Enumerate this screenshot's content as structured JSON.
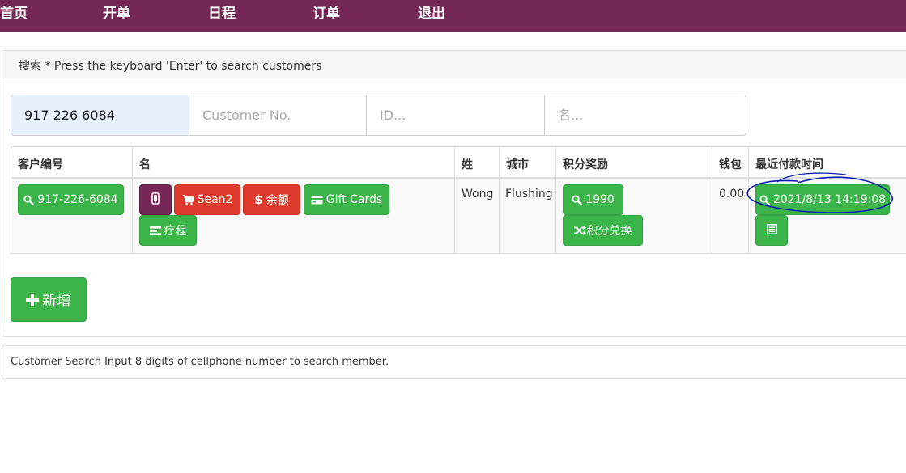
{
  "nav": {
    "items": [
      "首页",
      "开单",
      "日程",
      "订单",
      "退出"
    ]
  },
  "search_panel": {
    "heading": "搜索 * Press the keyboard 'Enter' to search customers",
    "fields": {
      "phone_value": "917 226 6084",
      "customer_no_placeholder": "Customer No.",
      "id_placeholder": "ID...",
      "name_placeholder": "名..."
    }
  },
  "table": {
    "headers": [
      "客户编号",
      "名",
      "姓",
      "城市",
      "积分奖励",
      "钱包",
      "最近付款时间"
    ],
    "row": {
      "customer_no": "917-226-6084",
      "actions": {
        "cart": "Sean2",
        "balance": "余额",
        "gift_cards": "Gift Cards",
        "treatment": "疗程"
      },
      "last_name": "Wong",
      "city": "Flushing",
      "points": "1990",
      "points_redeem": "积分兑换",
      "wallet": "0.00",
      "last_payment": "2021/8/13 14:19:08"
    }
  },
  "add_button": "新增",
  "footer_text": "Customer Search Input 8 digits of cellphone number to search member.",
  "colors": {
    "nav_bg": "#752756",
    "green": "#3bb54a",
    "red": "#de3b2c",
    "annotation": "#0a1fb5"
  }
}
